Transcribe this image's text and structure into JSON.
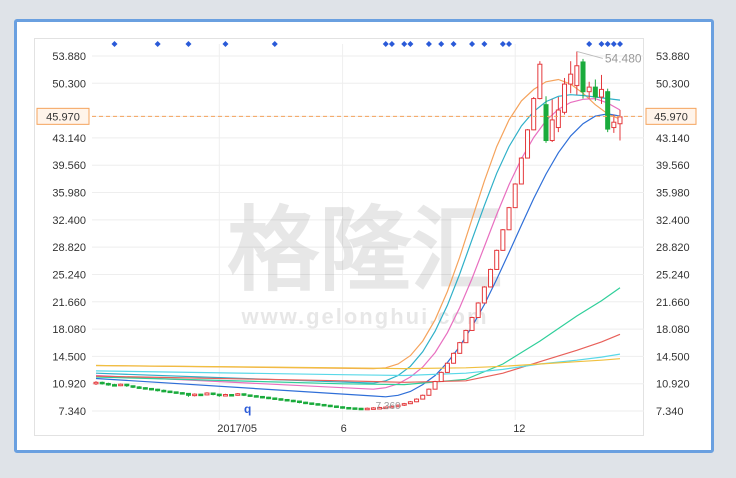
{
  "chart_data": {
    "type": "candlestick",
    "yticks": [
      "53.880",
      "50.300",
      "45.970",
      "43.140",
      "39.560",
      "35.980",
      "32.400",
      "28.820",
      "25.240",
      "21.660",
      "18.080",
      "14.500",
      "10.920",
      "7.340"
    ],
    "ylim": [
      7.34,
      53.88
    ],
    "xtick_labels": [
      "2017/05",
      "6",
      "12"
    ],
    "reference_line": {
      "label": "45.970",
      "value": 45.97,
      "color": "#f5a35c"
    },
    "annotations": [
      {
        "text": "54.480",
        "value": 54.48
      },
      {
        "text": "7.360",
        "value": 7.36
      },
      {
        "text": "q",
        "value": 7.6
      }
    ],
    "watermark": {
      "brand": "格隆汇",
      "url": "www.gelonghui.com"
    },
    "colors": {
      "up": "#e4393c",
      "down": "#1aab3c",
      "dot": "#2a5ad8",
      "frame": "#6aa0e0"
    },
    "candles": [
      [
        10.9,
        11.1,
        11.25,
        10.75
      ],
      [
        11.1,
        10.95,
        11.2,
        10.8
      ],
      [
        10.95,
        10.8,
        11.05,
        10.65
      ],
      [
        10.8,
        10.7,
        10.9,
        10.55
      ],
      [
        10.7,
        10.85,
        10.95,
        10.6
      ],
      [
        10.85,
        10.65,
        10.9,
        10.5
      ],
      [
        10.65,
        10.5,
        10.7,
        10.35
      ],
      [
        10.5,
        10.4,
        10.6,
        10.25
      ],
      [
        10.4,
        10.3,
        10.45,
        10.15
      ],
      [
        10.3,
        10.2,
        10.35,
        10.05
      ],
      [
        10.2,
        10.05,
        10.25,
        9.9
      ],
      [
        10.05,
        9.95,
        10.15,
        9.8
      ],
      [
        9.95,
        9.85,
        10.0,
        9.7
      ],
      [
        9.85,
        9.75,
        9.9,
        9.6
      ],
      [
        9.75,
        9.65,
        9.8,
        9.5
      ],
      [
        9.65,
        9.4,
        9.7,
        9.2
      ],
      [
        9.4,
        9.55,
        9.65,
        9.25
      ],
      [
        9.55,
        9.45,
        9.6,
        9.3
      ],
      [
        9.45,
        9.7,
        9.8,
        9.4
      ],
      [
        9.7,
        9.55,
        9.75,
        9.4
      ],
      [
        9.55,
        9.35,
        9.6,
        9.2
      ],
      [
        9.35,
        9.5,
        9.6,
        9.25
      ],
      [
        9.5,
        9.4,
        9.55,
        9.3
      ],
      [
        9.4,
        9.6,
        9.7,
        9.35
      ],
      [
        9.6,
        9.45,
        9.65,
        9.3
      ],
      [
        9.45,
        9.35,
        9.5,
        9.2
      ],
      [
        9.35,
        9.25,
        9.4,
        9.1
      ],
      [
        9.25,
        9.15,
        9.3,
        9.0
      ],
      [
        9.15,
        9.05,
        9.2,
        8.9
      ],
      [
        9.05,
        8.95,
        9.1,
        8.8
      ],
      [
        8.95,
        8.85,
        9.0,
        8.7
      ],
      [
        8.85,
        8.75,
        8.9,
        8.6
      ],
      [
        8.75,
        8.65,
        8.8,
        8.5
      ],
      [
        8.65,
        8.5,
        8.7,
        8.35
      ],
      [
        8.5,
        8.4,
        8.55,
        8.25
      ],
      [
        8.4,
        8.3,
        8.45,
        8.15
      ],
      [
        8.3,
        8.2,
        8.35,
        8.05
      ],
      [
        8.2,
        8.1,
        8.25,
        7.95
      ],
      [
        8.1,
        8.0,
        8.15,
        7.85
      ],
      [
        8.0,
        7.9,
        8.05,
        7.75
      ],
      [
        7.9,
        7.8,
        7.95,
        7.65
      ],
      [
        7.8,
        7.75,
        7.85,
        7.6
      ],
      [
        7.75,
        7.7,
        7.8,
        7.55
      ],
      [
        7.7,
        7.65,
        7.75,
        7.5
      ],
      [
        7.65,
        7.7,
        7.8,
        7.5
      ],
      [
        7.7,
        7.75,
        7.85,
        7.55
      ],
      [
        7.75,
        7.8,
        7.9,
        7.6
      ],
      [
        7.8,
        7.85,
        7.95,
        7.7
      ],
      [
        7.85,
        7.95,
        8.05,
        7.75
      ],
      [
        7.95,
        8.1,
        8.2,
        7.85
      ],
      [
        8.1,
        8.3,
        8.4,
        8.0
      ],
      [
        8.3,
        8.55,
        8.65,
        8.25
      ],
      [
        8.55,
        8.9,
        9.0,
        8.5
      ],
      [
        8.9,
        9.4,
        9.5,
        8.85
      ],
      [
        9.4,
        10.2,
        10.3,
        9.35
      ],
      [
        10.2,
        11.2,
        11.3,
        10.15
      ],
      [
        11.2,
        12.4,
        12.5,
        11.15
      ],
      [
        12.4,
        13.6,
        13.7,
        12.35
      ],
      [
        13.6,
        14.9,
        15.0,
        13.55
      ],
      [
        14.9,
        16.3,
        16.4,
        14.85
      ],
      [
        16.3,
        17.9,
        18.0,
        16.25
      ],
      [
        17.9,
        19.6,
        19.7,
        17.85
      ],
      [
        19.6,
        21.5,
        21.6,
        19.55
      ],
      [
        21.5,
        23.6,
        23.7,
        21.45
      ],
      [
        23.6,
        25.9,
        26.0,
        23.55
      ],
      [
        25.9,
        28.4,
        28.5,
        25.85
      ],
      [
        28.4,
        31.1,
        31.2,
        28.35
      ],
      [
        31.1,
        34.0,
        34.1,
        31.05
      ],
      [
        34.0,
        37.1,
        37.2,
        33.95
      ],
      [
        37.1,
        40.5,
        40.6,
        37.05
      ],
      [
        40.5,
        44.2,
        44.3,
        40.45
      ],
      [
        44.2,
        48.3,
        48.5,
        44.15
      ],
      [
        48.3,
        52.8,
        53.2,
        48.2
      ],
      [
        47.5,
        42.8,
        48.6,
        42.5
      ],
      [
        42.8,
        45.5,
        48.2,
        42.6
      ],
      [
        44.5,
        46.8,
        48.5,
        43.9
      ],
      [
        46.5,
        50.2,
        51.0,
        46.2
      ],
      [
        50.2,
        51.5,
        53.2,
        49.0
      ],
      [
        50.0,
        52.6,
        54.48,
        48.8
      ],
      [
        53.1,
        49.2,
        53.5,
        48.3
      ],
      [
        49.2,
        49.8,
        50.5,
        48.3
      ],
      [
        49.8,
        48.5,
        50.8,
        48.0
      ],
      [
        48.5,
        49.5,
        51.4,
        47.6
      ],
      [
        49.2,
        44.3,
        49.6,
        43.9
      ],
      [
        44.5,
        45.2,
        46.2,
        43.8
      ],
      [
        45.0,
        45.9,
        46.8,
        42.8
      ]
    ],
    "ma_lines": [
      {
        "color": "#f5a35c",
        "points": [
          [
            0,
            13.3
          ],
          [
            45,
            12.9
          ],
          [
            47,
            13.0
          ],
          [
            49,
            13.5
          ],
          [
            51,
            14.6
          ],
          [
            53,
            16.5
          ],
          [
            55,
            19.3
          ],
          [
            57,
            23.0
          ],
          [
            59,
            27.5
          ],
          [
            61,
            32.5
          ],
          [
            63,
            37.5
          ],
          [
            65,
            42.0
          ],
          [
            67,
            45.5
          ],
          [
            69,
            48.0
          ],
          [
            71,
            49.5
          ],
          [
            73,
            50.5
          ],
          [
            75,
            50.8
          ],
          [
            77,
            50.2
          ],
          [
            79,
            49.0
          ],
          [
            81,
            47.5
          ],
          [
            83,
            46.3
          ],
          [
            85,
            45.6
          ]
        ]
      },
      {
        "color": "#2fb0c8",
        "points": [
          [
            0,
            12.3
          ],
          [
            45,
            11.0
          ],
          [
            47,
            11.3
          ],
          [
            49,
            12.0
          ],
          [
            51,
            13.2
          ],
          [
            53,
            15.1
          ],
          [
            55,
            17.8
          ],
          [
            57,
            21.2
          ],
          [
            59,
            25.3
          ],
          [
            61,
            29.8
          ],
          [
            63,
            34.3
          ],
          [
            65,
            38.5
          ],
          [
            67,
            42.0
          ],
          [
            69,
            44.7
          ],
          [
            71,
            46.6
          ],
          [
            73,
            47.9
          ],
          [
            75,
            48.6
          ],
          [
            77,
            48.8
          ],
          [
            79,
            48.7
          ],
          [
            81,
            48.5
          ],
          [
            83,
            48.3
          ],
          [
            85,
            48.1
          ]
        ]
      },
      {
        "color": "#e86fc0",
        "points": [
          [
            0,
            12.0
          ],
          [
            45,
            10.2
          ],
          [
            47,
            10.4
          ],
          [
            49,
            10.9
          ],
          [
            51,
            11.8
          ],
          [
            53,
            13.1
          ],
          [
            55,
            15.0
          ],
          [
            57,
            17.6
          ],
          [
            59,
            20.9
          ],
          [
            61,
            24.7
          ],
          [
            63,
            28.9
          ],
          [
            65,
            33.1
          ],
          [
            67,
            37.0
          ],
          [
            69,
            40.4
          ],
          [
            71,
            43.2
          ],
          [
            73,
            45.4
          ],
          [
            75,
            46.9
          ],
          [
            77,
            47.8
          ],
          [
            79,
            48.2
          ],
          [
            81,
            48.3
          ],
          [
            83,
            47.7
          ],
          [
            85,
            46.8
          ]
        ]
      },
      {
        "color": "#2f6fd8",
        "points": [
          [
            0,
            11.6
          ],
          [
            45,
            9.3
          ],
          [
            47,
            9.2
          ],
          [
            49,
            9.4
          ],
          [
            51,
            9.9
          ],
          [
            53,
            10.8
          ],
          [
            55,
            12.0
          ],
          [
            57,
            13.7
          ],
          [
            59,
            15.8
          ],
          [
            61,
            18.4
          ],
          [
            63,
            21.3
          ],
          [
            65,
            24.6
          ],
          [
            67,
            28.1
          ],
          [
            69,
            31.7
          ],
          [
            71,
            35.2
          ],
          [
            73,
            38.4
          ],
          [
            75,
            41.2
          ],
          [
            77,
            43.4
          ],
          [
            79,
            45.0
          ],
          [
            81,
            46.0
          ],
          [
            83,
            46.3
          ],
          [
            85,
            46.0
          ]
        ]
      },
      {
        "color": "#2fcf9a",
        "points": [
          [
            0,
            11.8
          ],
          [
            40,
            10.9
          ],
          [
            50,
            10.8
          ],
          [
            60,
            11.5
          ],
          [
            66,
            13.5
          ],
          [
            72,
            16.5
          ],
          [
            78,
            19.8
          ],
          [
            82,
            21.8
          ],
          [
            85,
            23.5
          ]
        ]
      },
      {
        "color": "#e8605a",
        "points": [
          [
            0,
            11.9
          ],
          [
            40,
            11.3
          ],
          [
            50,
            11.1
          ],
          [
            60,
            11.3
          ],
          [
            66,
            12.3
          ],
          [
            72,
            13.8
          ],
          [
            78,
            15.3
          ],
          [
            82,
            16.4
          ],
          [
            85,
            17.4
          ]
        ]
      },
      {
        "color": "#59d8e8",
        "points": [
          [
            0,
            12.6
          ],
          [
            40,
            12.1
          ],
          [
            50,
            12.0
          ],
          [
            60,
            12.3
          ],
          [
            66,
            12.8
          ],
          [
            72,
            13.5
          ],
          [
            78,
            14.0
          ],
          [
            82,
            14.4
          ],
          [
            85,
            14.8
          ]
        ]
      },
      {
        "color": "#f0c040",
        "points": [
          [
            0,
            13.3
          ],
          [
            40,
            13.0
          ],
          [
            50,
            12.9
          ],
          [
            60,
            13.0
          ],
          [
            66,
            13.2
          ],
          [
            72,
            13.5
          ],
          [
            78,
            13.8
          ],
          [
            82,
            14.0
          ],
          [
            85,
            14.2
          ]
        ]
      }
    ],
    "series_dots": [
      3,
      10,
      15,
      21,
      29,
      47,
      48,
      50,
      51,
      54,
      56,
      58,
      61,
      63,
      66,
      67,
      80,
      82,
      83,
      84,
      85
    ],
    "xtick_positions": [
      20,
      40,
      68
    ]
  }
}
